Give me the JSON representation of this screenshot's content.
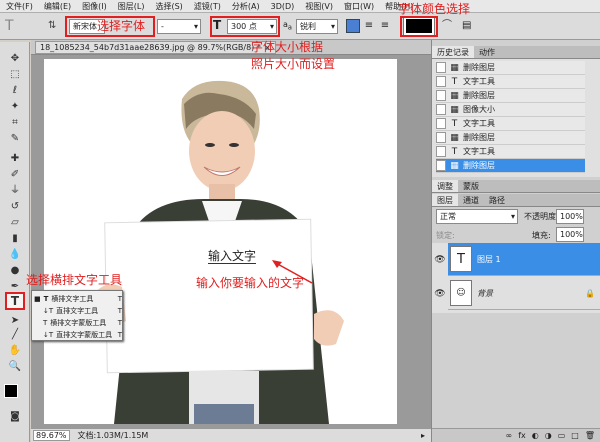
{
  "menu": [
    "文件(F)",
    "编辑(E)",
    "图像(I)",
    "图层(L)",
    "选择(S)",
    "滤镜(T)",
    "分析(A)",
    "3D(D)",
    "视图(V)",
    "窗口(W)",
    "帮助(H)"
  ],
  "options": {
    "font_family": "新宋体",
    "font_style": "-",
    "font_size": "300 点",
    "aa_label": "a",
    "aa_mode": "锐利"
  },
  "annotations": {
    "select_font": "选择字体",
    "font_color": "字体颜色选择",
    "font_size_l1": "字体大小根据",
    "font_size_l2": "照片大小而设置",
    "horizontal_tool": "选择横排文字工具",
    "input_text": "输入你要输入的文字",
    "colors": {
      "red": "#e02020"
    }
  },
  "document": {
    "tab_title": "18_1085234_54b7d31aae28639.jpg @ 89.7%(RGB/8) *",
    "close": "×",
    "canvas_text": "输入文字",
    "zoom": "89.67%",
    "doc_info": "文档:1.03M/1.15M"
  },
  "tool_flyout": {
    "items": [
      {
        "label": "横排文字工具",
        "key": "T"
      },
      {
        "label": "直排文字工具",
        "key": "T"
      },
      {
        "label": "横排文字蒙版工具",
        "key": "T"
      },
      {
        "label": "直排文字蒙版工具",
        "key": "T"
      }
    ]
  },
  "history_panel": {
    "tabs": [
      "历史记录",
      "动作"
    ],
    "items": [
      {
        "label": "删除图层",
        "icon": "layer-icon"
      },
      {
        "label": "文字工具",
        "icon": "T"
      },
      {
        "label": "删除图层",
        "icon": "layer-icon"
      },
      {
        "label": "图像大小",
        "icon": "layer-icon"
      },
      {
        "label": "文字工具",
        "icon": "T"
      },
      {
        "label": "删除图层",
        "icon": "layer-icon"
      },
      {
        "label": "文字工具",
        "icon": "T"
      },
      {
        "label": "删除图层",
        "icon": "layer-icon",
        "selected": true
      }
    ]
  },
  "adjust_panel": {
    "tabs": [
      "调整",
      "蒙版"
    ]
  },
  "layers_panel": {
    "tabs": [
      "图层",
      "通道",
      "路径"
    ],
    "blend_mode": "正常",
    "opacity_label": "不透明度:",
    "opacity": "100%",
    "lock_label": "锁定:",
    "fill_label": "填充:",
    "fill": "100%",
    "layers": [
      {
        "name": "图层 1",
        "thumb": "T",
        "selected": true
      },
      {
        "name": "背景",
        "thumb": "photo",
        "selected": false
      }
    ]
  }
}
